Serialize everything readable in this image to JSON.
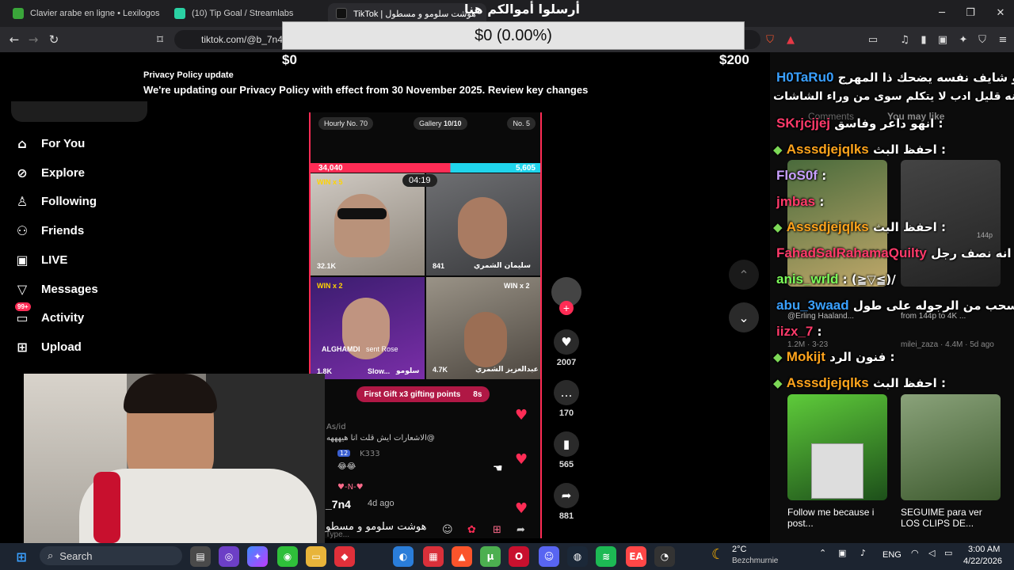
{
  "tabs": [
    {
      "title": "Clavier arabe en ligne • Lexilogos",
      "icon": "lexilogos-icon",
      "color": "#3aa53a"
    },
    {
      "title": "(10) Tip Goal / Streamlabs",
      "icon": "streamlabs-icon",
      "color": "#2ad1a3"
    },
    {
      "title": "TikTok | هوشت سلومو و مسطول",
      "icon": "tiktok-icon",
      "color": "#111111"
    }
  ],
  "address_bar": {
    "url": "tiktok.com/@b_7n4"
  },
  "overlay": {
    "arabic_title": "أرسلوا أموالكم هنا",
    "goal_text": "$0 (0.00%)",
    "min_label": "$0",
    "max_label": "$200"
  },
  "privacy": {
    "title": "Privacy Policy update",
    "text": "We're updating our Privacy Policy with effect from 30 November 2025. Review key changes"
  },
  "sidebar": {
    "items": [
      {
        "label": "For You",
        "icon": "home-icon"
      },
      {
        "label": "Explore",
        "icon": "compass-icon"
      },
      {
        "label": "Following",
        "icon": "following-icon"
      },
      {
        "label": "Friends",
        "icon": "friends-icon"
      },
      {
        "label": "LIVE",
        "icon": "live-icon"
      },
      {
        "label": "Messages",
        "icon": "messages-icon"
      },
      {
        "label": "Activity",
        "icon": "activity-icon",
        "badge": "99+"
      },
      {
        "label": "Upload",
        "icon": "upload-icon"
      }
    ]
  },
  "video": {
    "hourly": "Hourly No. 70",
    "gallery": "Gallery",
    "gallery_count": "10/10",
    "rank": "No. 5",
    "score_left": "34,040",
    "score_right": "5,605",
    "timer": "04:19",
    "tiles": [
      {
        "win": "WIN x 5",
        "count": "32.1K",
        "name": ""
      },
      {
        "win": "",
        "count": "841",
        "name": "سليمان الشمري"
      },
      {
        "win": "WIN x 2",
        "count": "1.8K",
        "name": "ALGHAMDI",
        "extra": "sent Rose",
        "extra2": "Slow...",
        "extra3": "سلومو"
      },
      {
        "win": "WIN x 2",
        "count": "4.7K",
        "name": "عبدالعزيز الشمري"
      }
    ],
    "first_gift": "First Gift x3 gifting points",
    "first_gift_time": "8s",
    "comments": [
      {
        "user": "As/id",
        "text": "الاشعارات ايش قلت انا هيهههه@"
      },
      {
        "user": "K333",
        "badge": "12",
        "text": "😂😂"
      },
      {
        "user": "",
        "text": "♥-N-♥"
      }
    ],
    "handle": "_7n4",
    "age": "4d ago",
    "caption": "هوشت سلومو و مسطو",
    "input_placeholder": "Type..."
  },
  "actions": {
    "likes": "2007",
    "comments": "170",
    "saves": "565",
    "shares": "881"
  },
  "right_panel": {
    "tabs": [
      "Comments",
      "You may like"
    ],
    "thumbs": [
      {
        "caption": "",
        "meta": ""
      },
      {
        "caption": "",
        "meta": "144p"
      },
      {
        "caption": "@Erling Haaland...",
        "meta": "1.2M · 3-23"
      },
      {
        "caption": "from 144p to 4K ...",
        "meta": "milei_zaza · 4.4M · 5d ago"
      },
      {
        "caption": "Follow me because i post...",
        "meta": ""
      },
      {
        "caption": "SEGUIME para ver LOS CLIPS DE...",
        "meta": ""
      }
    ],
    "chat": [
      {
        "user": "H0TaRu0",
        "msg": "هو شايف نفسه يضحك ذا المهرج :",
        "color": "#3aa0ff"
      },
      {
        "user": "",
        "msg": "لكنه قليل ادب لا يتكلم سوى من وراء الشاشات",
        "color": "#ffffff"
      },
      {
        "user": "SKrjcjjej",
        "msg": "انهو داعر وفاسق :",
        "color": "#ff3a6a"
      },
      {
        "user": "Asssdjejqlks",
        "msg": "احفظ البث :",
        "color": "#ffa41c"
      },
      {
        "user": "FloS0f",
        "msg": ":",
        "color": "#c9a0ff"
      },
      {
        "user": "jmbas",
        "msg": ":",
        "color": "#ff3a6a"
      },
      {
        "user": "Asssdjejqlks",
        "msg": "احفظ البث :",
        "color": "#ffa41c"
      },
      {
        "user": "FahadSalRahamaQuilty",
        "msg": "انه نصف رجل :",
        "color": "#ff3a6a"
      },
      {
        "user": "anis_wrld",
        "msg": ": (≧▽≦)/",
        "color": "#7dff5a"
      },
      {
        "user": "abu_3waad",
        "msg": "انسحب من الرجوله على طول :",
        "color": "#3aa0ff"
      },
      {
        "user": "iizx_7",
        "msg": ":",
        "color": "#ff3a6a"
      },
      {
        "user": "Mokijt",
        "msg": "فنون الرد :",
        "color": "#ffa41c"
      },
      {
        "user": "Asssdjejqlks",
        "msg": "احفظ البث :",
        "color": "#ffa41c"
      }
    ]
  },
  "taskbar": {
    "search_label": "Search",
    "weather_temp": "2°C",
    "weather_place": "Bezchmurnie",
    "lang": "ENG",
    "time": "3:00 AM",
    "date": "4/22/2026"
  }
}
